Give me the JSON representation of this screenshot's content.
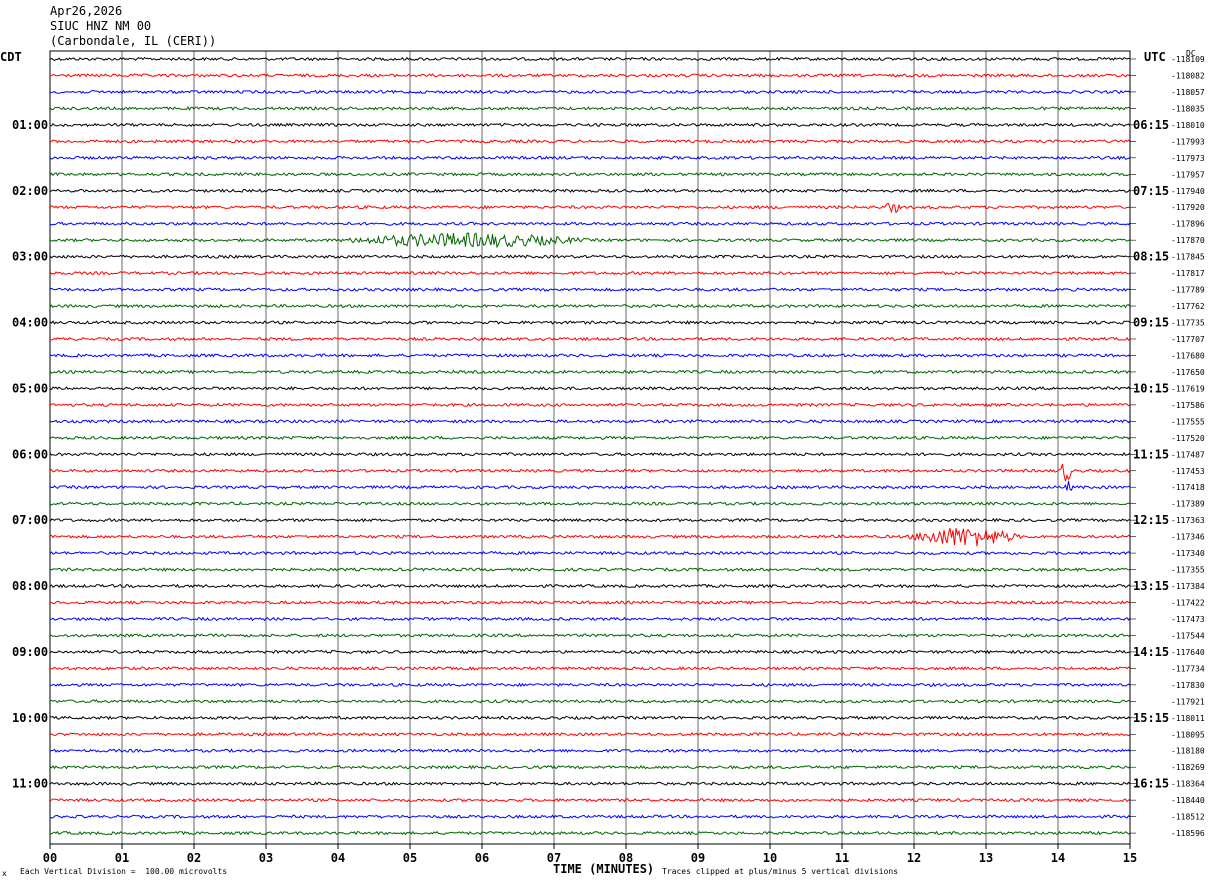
{
  "header": {
    "date": "Apr26,2026",
    "station": "SIUC HNZ NM 00",
    "location": "(Carbondale, IL (CERI))"
  },
  "tz_left": "CDT",
  "tz_right": "UTC",
  "dc_label": "DC",
  "footer": {
    "scale_note": "Each Vertical Division =  100.00 microvolts",
    "xlabel": "TIME (MINUTES)",
    "clip_note": "Traces clipped at plus/minus 5 vertical divisions",
    "corner_mark": "x"
  },
  "colors": {
    "trace_cycle": [
      "#000000",
      "#ff0000",
      "#0000ff",
      "#006400"
    ],
    "grid": "#000000"
  },
  "chart_data": {
    "type": "line",
    "xlabel": "TIME (MINUTES)",
    "xlim": [
      0,
      15
    ],
    "x_ticks": [
      "00",
      "01",
      "02",
      "03",
      "04",
      "05",
      "06",
      "07",
      "08",
      "09",
      "10",
      "11",
      "12",
      "13",
      "14",
      "15"
    ],
    "left_hour_labels": [
      "01:00",
      "02:00",
      "03:00",
      "04:00",
      "05:00",
      "06:00",
      "07:00",
      "08:00",
      "09:00",
      "10:00",
      "11:00"
    ],
    "right_hour_labels": [
      "06:15",
      "07:15",
      "08:15",
      "09:15",
      "10:15",
      "11:15",
      "12:15",
      "13:15",
      "14:15",
      "15:15",
      "16:15"
    ],
    "trace_offsets": [
      -118109,
      -118082,
      -118057,
      -118035,
      -118010,
      -117993,
      -117973,
      -117957,
      -117940,
      -117920,
      -117896,
      -117870,
      -117845,
      -117817,
      -117789,
      -117762,
      -117735,
      -117707,
      -117680,
      -117650,
      -117619,
      -117586,
      -117555,
      -117520,
      -117487,
      -117453,
      -117418,
      -117389,
      -117363,
      -117346,
      -117340,
      -117355,
      -117384,
      -117422,
      -117473,
      -117544,
      -117640,
      -117734,
      -117830,
      -117921,
      -118011,
      -118095,
      -118180,
      -118269,
      -118364,
      -118440,
      -118512,
      -118596
    ],
    "events": [
      {
        "trace": 11,
        "start_min": 4.0,
        "end_min": 7.5,
        "amplitude": 6
      },
      {
        "trace": 9,
        "start_min": 11.6,
        "end_min": 11.8,
        "amplitude": 6
      },
      {
        "trace": 25,
        "start_min": 14.0,
        "end_min": 14.2,
        "amplitude": 10
      },
      {
        "trace": 29,
        "start_min": 11.9,
        "end_min": 13.5,
        "amplitude": 9
      },
      {
        "trace": 26,
        "start_min": 14.1,
        "end_min": 14.2,
        "amplitude": 5
      }
    ]
  }
}
